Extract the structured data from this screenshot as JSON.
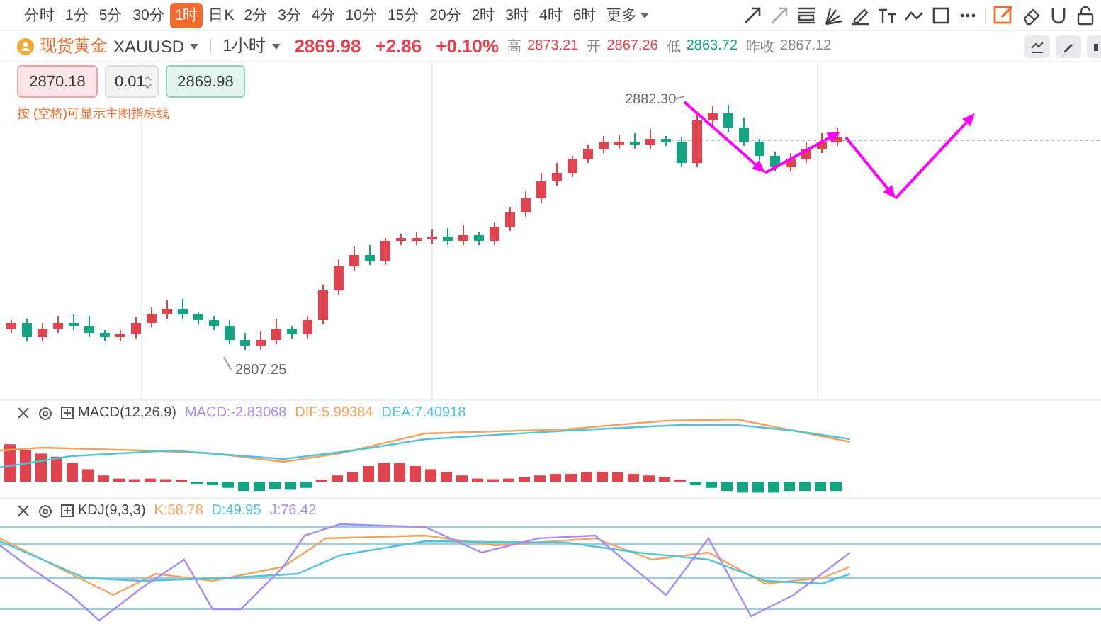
{
  "periods": [
    {
      "label": "分时",
      "selected": false,
      "kind": "tab"
    },
    {
      "label": "1分",
      "selected": false,
      "kind": "tab"
    },
    {
      "label": "5分",
      "selected": false,
      "kind": "tab"
    },
    {
      "label": "30分",
      "selected": false,
      "kind": "tab"
    },
    {
      "label": "1时",
      "selected": true,
      "kind": "tab"
    },
    {
      "label": "日K",
      "selected": false,
      "kind": "tab"
    },
    {
      "label": "2分",
      "selected": false,
      "kind": "tab"
    },
    {
      "label": "3分",
      "selected": false,
      "kind": "tab"
    },
    {
      "label": "4分",
      "selected": false,
      "kind": "tab"
    },
    {
      "label": "10分",
      "selected": false,
      "kind": "tab"
    },
    {
      "label": "15分",
      "selected": false,
      "kind": "tab"
    },
    {
      "label": "20分",
      "selected": false,
      "kind": "tab"
    },
    {
      "label": "2时",
      "selected": false,
      "kind": "tab"
    },
    {
      "label": "3时",
      "selected": false,
      "kind": "tab"
    },
    {
      "label": "4时",
      "selected": false,
      "kind": "tab"
    },
    {
      "label": "6时",
      "selected": false,
      "kind": "tab"
    },
    {
      "label": "更多",
      "selected": false,
      "kind": "menu"
    }
  ],
  "symbol": {
    "name": "现货黄金",
    "code": "XAUUSD",
    "interval": "1小时",
    "price": "2869.98",
    "change": "+2.86",
    "change_pct": "+0.10%",
    "stats": [
      {
        "label": "高",
        "value": "2873.21",
        "color": "#e0454f"
      },
      {
        "label": "开",
        "value": "2867.26",
        "color": "#e0454f"
      },
      {
        "label": "低",
        "value": "2863.72",
        "color": "#14a383"
      },
      {
        "label": "昨收",
        "value": "2867.12",
        "color": "#888888"
      }
    ]
  },
  "trade": {
    "sell": "2870.18",
    "lot": "0.01",
    "buy": "2869.98",
    "hint": "按 (空格)可显示主图指标线"
  },
  "chart": {
    "high_label": "2882.30",
    "low_label": "2807.25"
  },
  "macd": {
    "title": "MACD(12,26,9)",
    "items": [
      {
        "label": "MACD:-2.83068",
        "color": "#a78bfa"
      },
      {
        "label": "DIF:5.99384",
        "color": "#f5a25d"
      },
      {
        "label": "DEA:7.40918",
        "color": "#4fc3d9"
      }
    ]
  },
  "kdj": {
    "title": "KDJ(9,3,3)",
    "items": [
      {
        "label": "K:58.78",
        "color": "#f5a25d"
      },
      {
        "label": "D:49.95",
        "color": "#4fc3d9"
      },
      {
        "label": "J:76.42",
        "color": "#a78bfa"
      }
    ]
  }
}
